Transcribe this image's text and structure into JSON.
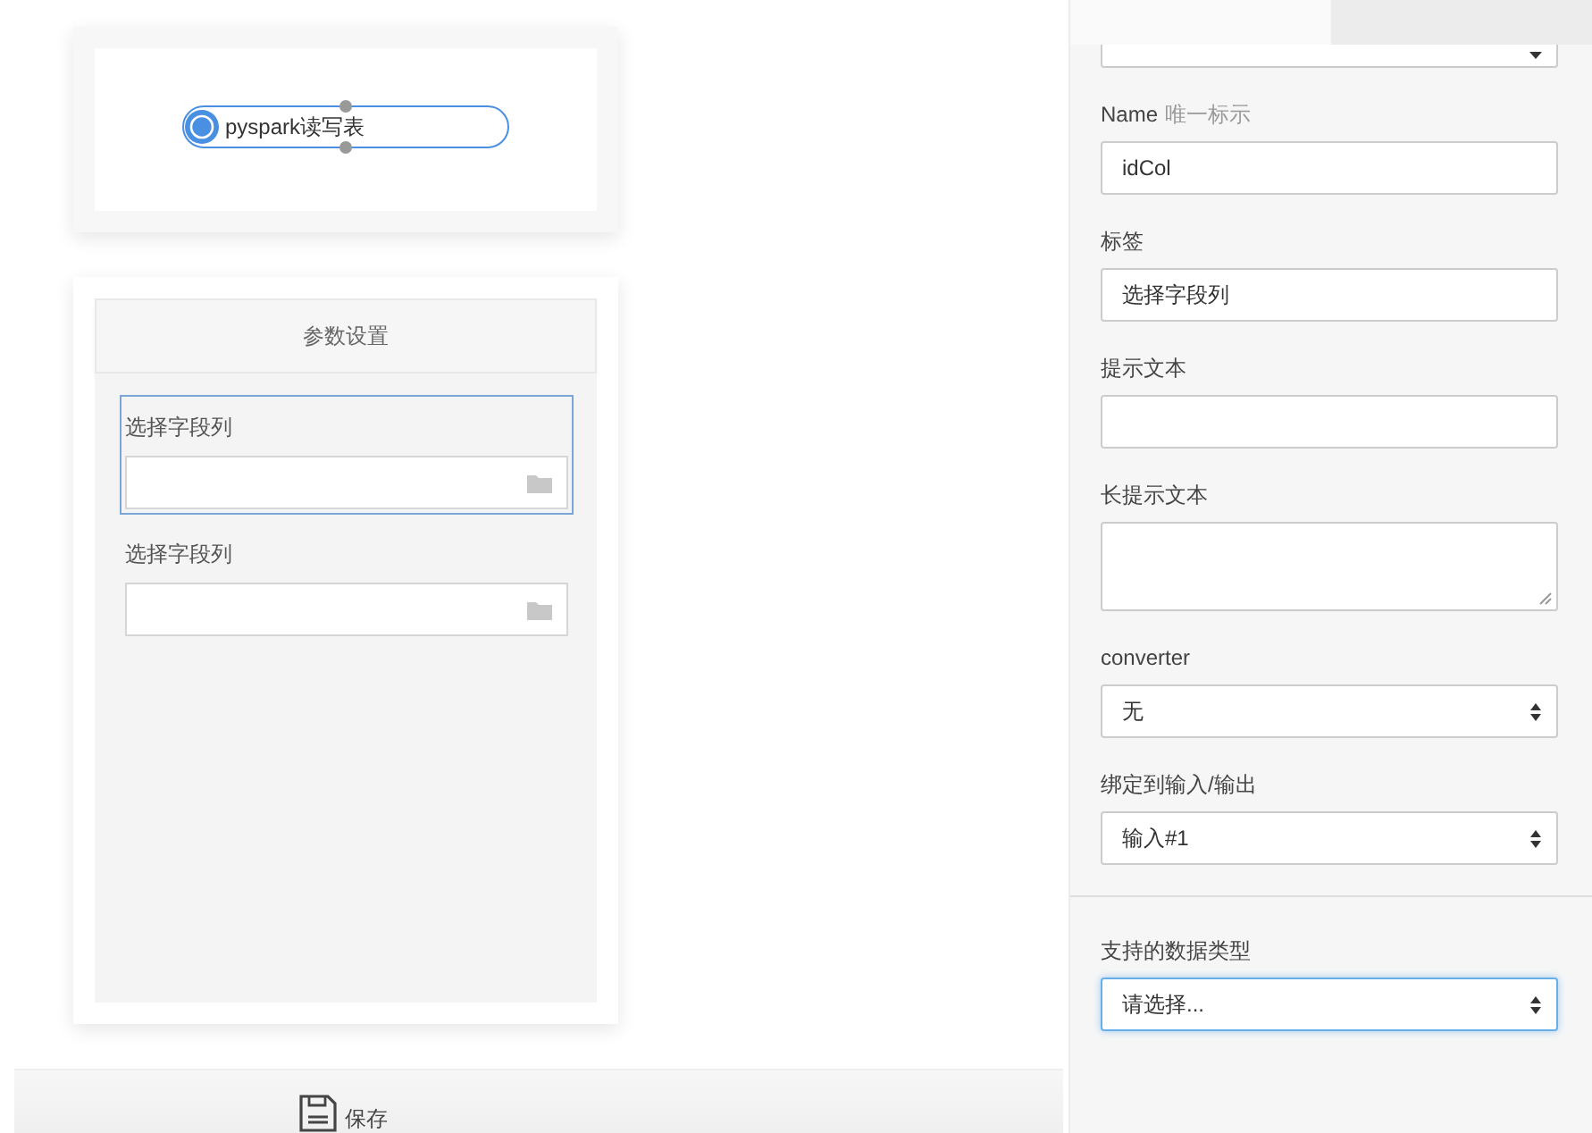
{
  "canvas": {
    "nodes": [
      {
        "label": "pyspark读写表",
        "selected": true
      }
    ]
  },
  "params_panel": {
    "title": "参数设置",
    "fields": [
      {
        "label": "选择字段列",
        "selected": true
      },
      {
        "label": "选择字段列",
        "selected": false
      }
    ]
  },
  "toolbar": {
    "buttons": [
      {
        "label": "保存"
      }
    ]
  },
  "properties": {
    "fields": [
      {
        "kind": "select",
        "focused": false
      },
      {
        "kind": "input",
        "label": "Name",
        "hint": "唯一标示",
        "value": "idCol"
      },
      {
        "kind": "input",
        "label": "标签",
        "value": "选择字段列"
      },
      {
        "kind": "input",
        "label": "提示文本"
      },
      {
        "kind": "textarea",
        "label": "长提示文本"
      },
      {
        "kind": "select",
        "label": "converter",
        "value": "无",
        "focused": false
      },
      {
        "kind": "select",
        "label": "绑定到输入/输出",
        "value": "输入#1",
        "focused": false
      },
      {
        "kind": "divider"
      },
      {
        "kind": "select",
        "label": "支持的数据类型",
        "value": "请选择...",
        "focused": true
      }
    ]
  }
}
